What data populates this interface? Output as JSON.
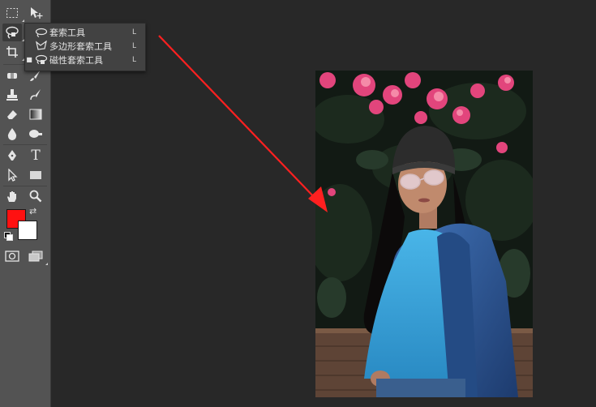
{
  "toolbar": {
    "tools": [
      {
        "name": "rectangular-marquee-tool",
        "icon": "rectangle-select-icon"
      },
      {
        "name": "move-tool",
        "icon": "move-icon"
      },
      {
        "name": "lasso-tool",
        "icon": "lasso-icon",
        "active": true
      },
      {
        "name": "crop-tool",
        "icon": "crop-icon"
      },
      {
        "name": "spot-healing-tool",
        "icon": "bandage-icon"
      },
      {
        "name": "brush-tool",
        "icon": "brush-icon"
      },
      {
        "name": "clone-stamp-tool",
        "icon": "stamp-icon"
      },
      {
        "name": "history-brush-tool",
        "icon": "history-brush-icon"
      },
      {
        "name": "eraser-tool",
        "icon": "eraser-icon"
      },
      {
        "name": "gradient-tool",
        "icon": "gradient-icon"
      },
      {
        "name": "blur-tool",
        "icon": "drop-icon"
      },
      {
        "name": "dodge-tool",
        "icon": "dodge-icon"
      },
      {
        "name": "pen-tool",
        "icon": "pen-icon"
      },
      {
        "name": "type-tool",
        "icon": "type-icon",
        "glyph": "T"
      },
      {
        "name": "path-selection-tool",
        "icon": "arrow-cursor-icon"
      },
      {
        "name": "shape-tool",
        "icon": "rectangle-shape-icon"
      },
      {
        "name": "hand-tool",
        "icon": "hand-icon"
      },
      {
        "name": "zoom-tool",
        "icon": "magnifier-icon"
      },
      {
        "name": "quick-mask-button",
        "icon": "quick-mask-icon"
      },
      {
        "name": "screen-mode-button",
        "icon": "screen-mode-icon"
      }
    ],
    "colors": {
      "foreground": "#ff1111",
      "background": "#ffffff"
    }
  },
  "flyout": {
    "items": [
      {
        "label": "套索工具",
        "shortcut": "L",
        "icon": "lasso-icon",
        "selected": false
      },
      {
        "label": "多边形套索工具",
        "shortcut": "L",
        "icon": "polygonal-lasso-icon",
        "selected": false
      },
      {
        "label": "磁性套索工具",
        "shortcut": "L",
        "icon": "magnetic-lasso-icon",
        "selected": true
      }
    ]
  },
  "annotation": {
    "color": "#ff2020"
  }
}
